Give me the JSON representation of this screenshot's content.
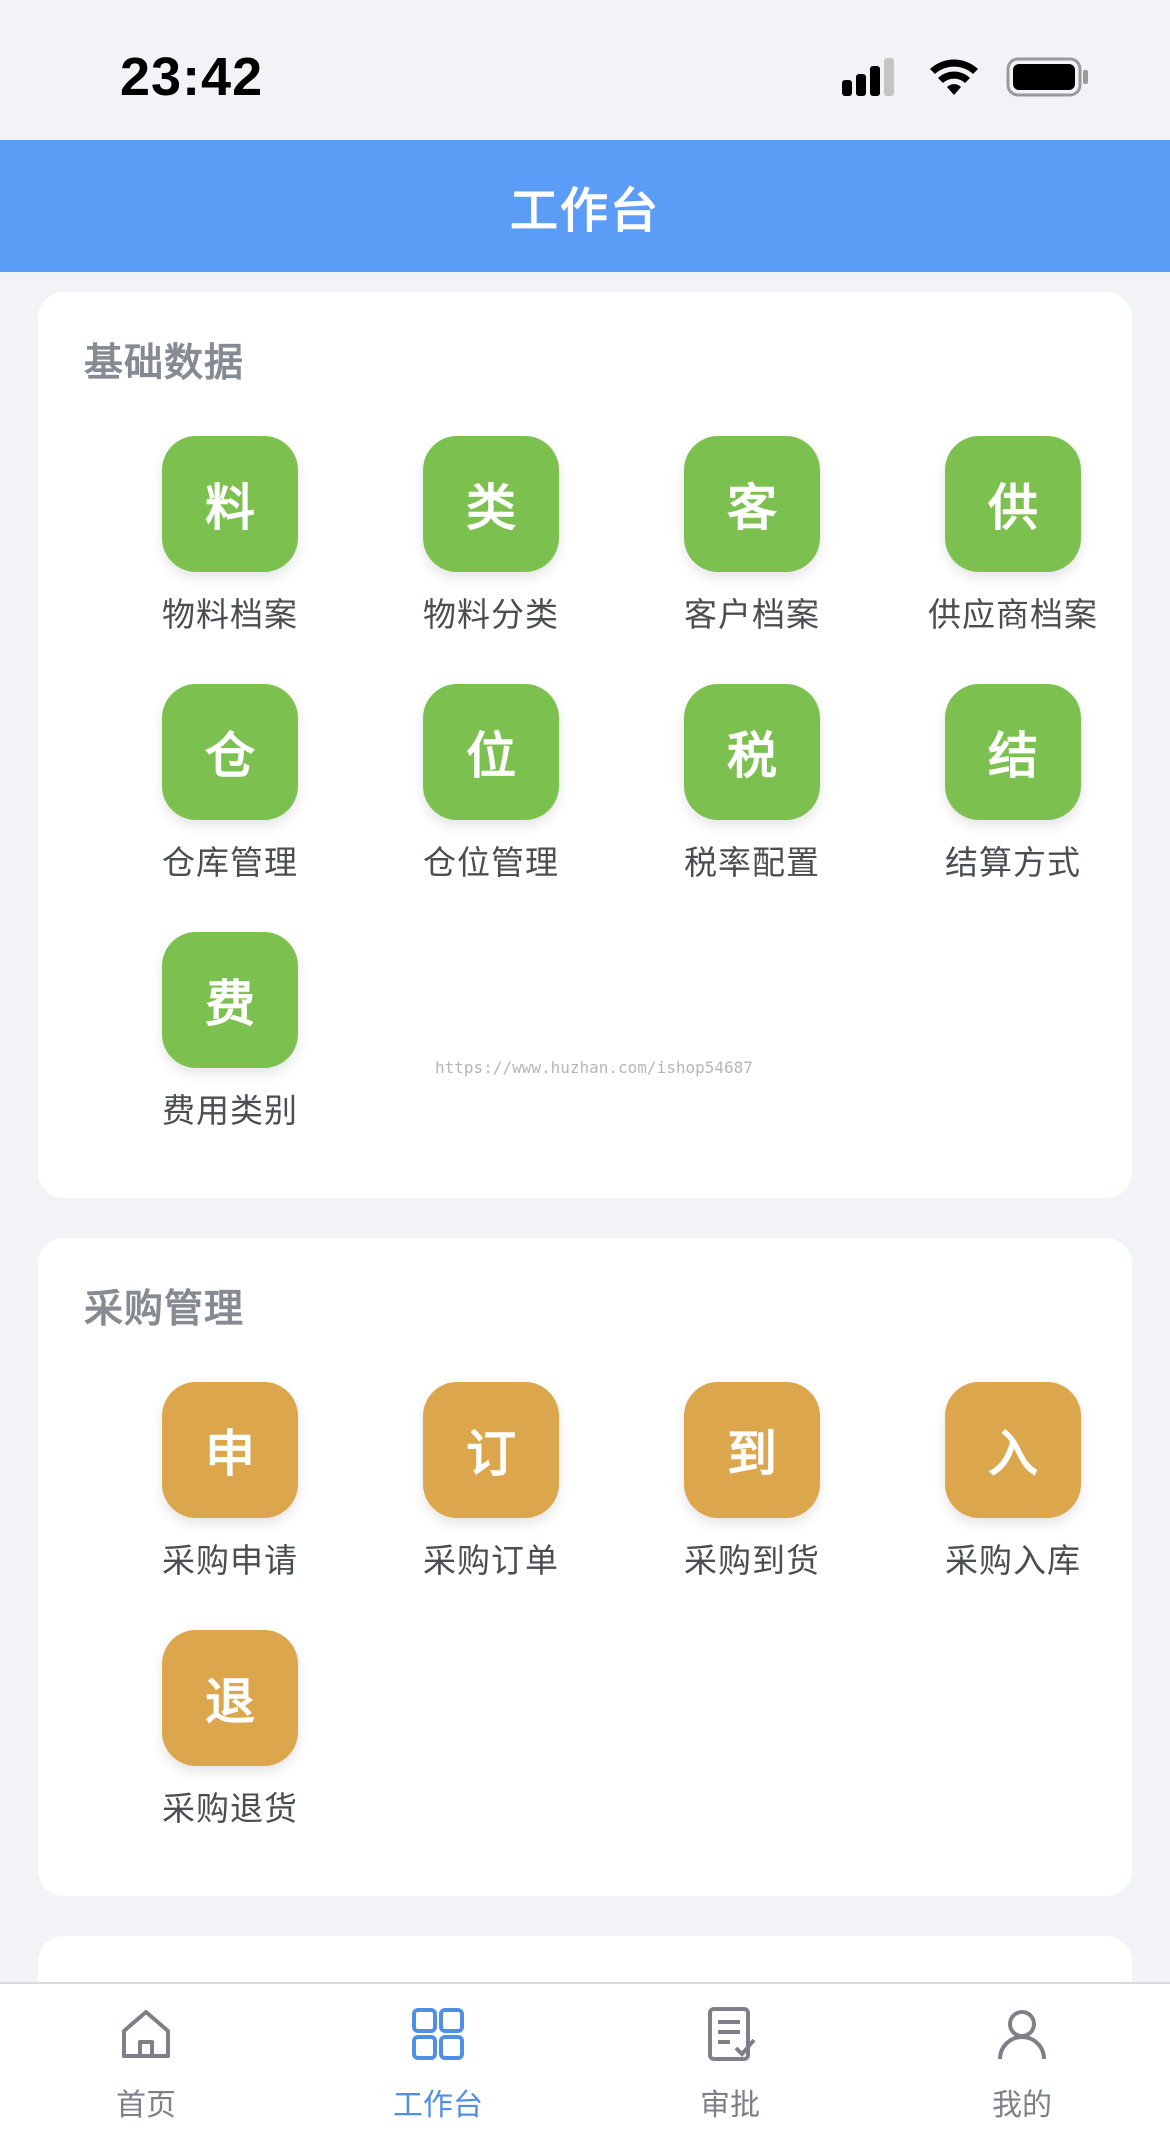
{
  "status_bar": {
    "time": "23:42"
  },
  "header": {
    "title": "工作台"
  },
  "sections": [
    {
      "title": "基础数据",
      "color": "#7cc150",
      "items": [
        {
          "glyph": "料",
          "label": "物料档案"
        },
        {
          "glyph": "类",
          "label": "物料分类"
        },
        {
          "glyph": "客",
          "label": "客户档案"
        },
        {
          "glyph": "供",
          "label": "供应商档案"
        },
        {
          "glyph": "仓",
          "label": "仓库管理"
        },
        {
          "glyph": "位",
          "label": "仓位管理"
        },
        {
          "glyph": "税",
          "label": "税率配置"
        },
        {
          "glyph": "结",
          "label": "结算方式"
        },
        {
          "glyph": "费",
          "label": "费用类别"
        }
      ]
    },
    {
      "title": "采购管理",
      "color": "#dca64d",
      "items": [
        {
          "glyph": "申",
          "label": "采购申请"
        },
        {
          "glyph": "订",
          "label": "采购订单"
        },
        {
          "glyph": "到",
          "label": "采购到货"
        },
        {
          "glyph": "入",
          "label": "采购入库"
        },
        {
          "glyph": "退",
          "label": "采购退货"
        }
      ]
    }
  ],
  "watermark": "https://www.huzhan.com/ishop54687",
  "tab_bar": {
    "active_color": "#4f8fe6",
    "tabs": [
      {
        "label": "首页",
        "icon": "home-icon"
      },
      {
        "label": "工作台",
        "icon": "grid-icon"
      },
      {
        "label": "审批",
        "icon": "approval-icon"
      },
      {
        "label": "我的",
        "icon": "user-icon"
      }
    ]
  }
}
